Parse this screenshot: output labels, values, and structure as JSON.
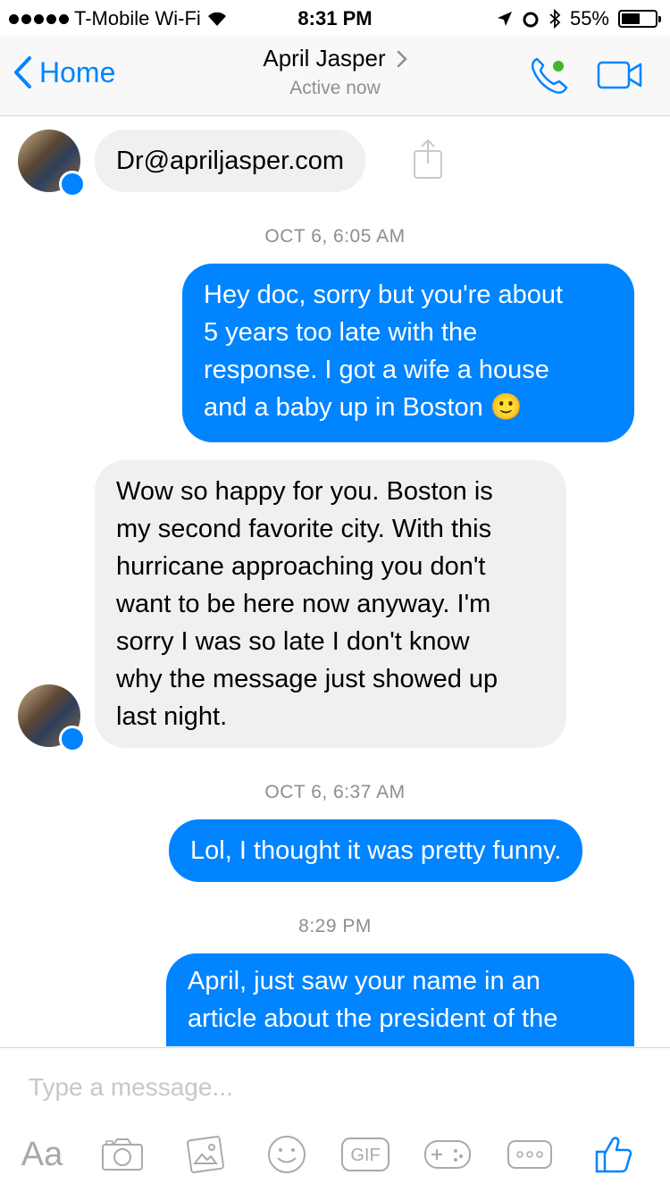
{
  "status_bar": {
    "carrier": "T-Mobile Wi-Fi",
    "time": "8:31 PM",
    "battery": "55%",
    "battery_level": 0.55
  },
  "nav": {
    "back_label": "Home",
    "title": "April Jasper",
    "subtitle": "Active now",
    "accent": "#0084ff",
    "online_color": "#42b72a"
  },
  "messages": [
    {
      "sender": "them",
      "text": "Dr@apriljasper.com"
    },
    {
      "sender": "timestamp",
      "text": "OCT 6, 6:05 AM"
    },
    {
      "sender": "me",
      "lines": [
        "Hey doc, sorry but you're about",
        "5 years too late with the",
        "response. I got a wife a house",
        "and a baby up in Boston 🙂"
      ]
    },
    {
      "sender": "them",
      "lines": [
        "Wow so happy for you. Boston is",
        "my second favorite city. With this",
        "hurricane approaching you don't",
        "want to be here now anyway. I'm",
        "sorry I was so late  I don't know",
        "why the message just showed up",
        "last night."
      ]
    },
    {
      "sender": "timestamp",
      "text": "OCT 6, 6:37 AM"
    },
    {
      "sender": "me",
      "text": "Lol, I thought it was pretty funny."
    },
    {
      "sender": "timestamp",
      "text": "8:29 PM"
    },
    {
      "sender": "me",
      "lines": [
        "April, just saw your name in an",
        "article about the president of the"
      ]
    }
  ],
  "composer": {
    "placeholder": "Type a message...",
    "tools": [
      {
        "icon": "text-format-icon",
        "label": "Aa"
      },
      {
        "icon": "camera-icon"
      },
      {
        "icon": "photo-icon"
      },
      {
        "icon": "emoji-icon"
      },
      {
        "icon": "gif-icon",
        "label": "GIF"
      },
      {
        "icon": "game-controller-icon"
      },
      {
        "icon": "more-icon"
      },
      {
        "icon": "thumbs-up-icon"
      }
    ]
  }
}
